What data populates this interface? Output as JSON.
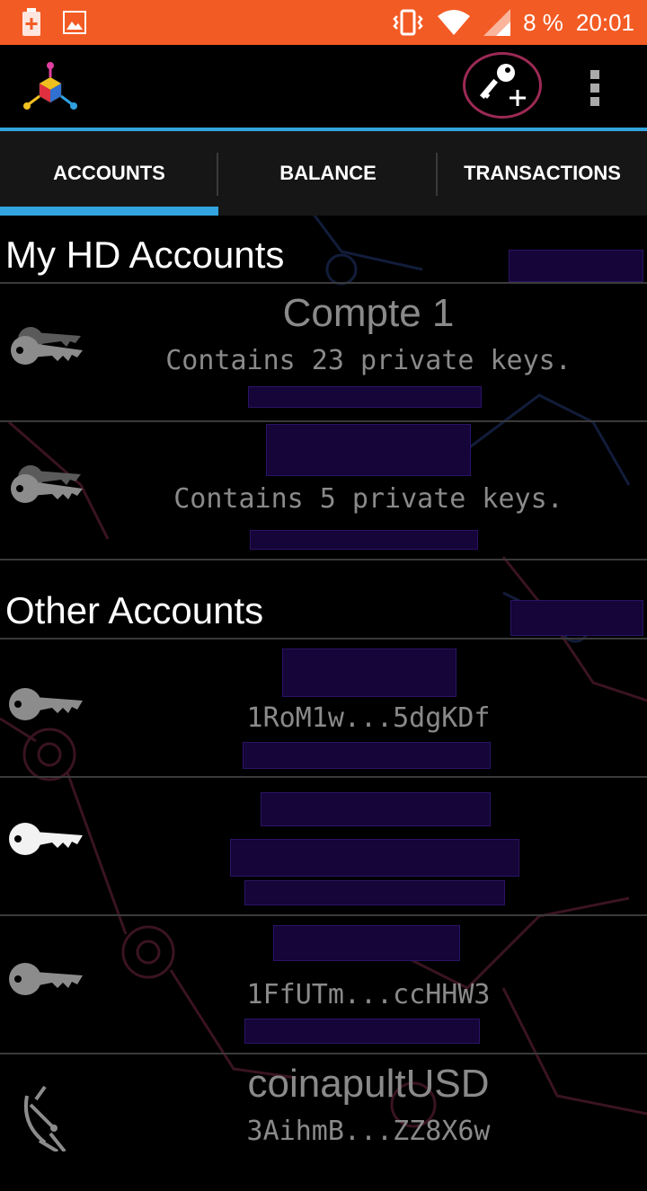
{
  "status_bar": {
    "battery_percent": "8 %",
    "time": "20:01",
    "icons": [
      "battery-saver-icon",
      "image-notification-icon",
      "vibrate-icon",
      "wifi-icon",
      "cell-signal-icon"
    ]
  },
  "action_bar": {
    "logo_icon": "mycelium-logo-icon",
    "add_key_icon": "add-key-icon",
    "overflow_icon": "overflow-menu-icon"
  },
  "tabs": [
    {
      "label": "ACCOUNTS",
      "selected": true
    },
    {
      "label": "BALANCE",
      "selected": false
    },
    {
      "label": "TRANSACTIONS",
      "selected": false
    }
  ],
  "sections": {
    "hd": {
      "title": "My HD Accounts"
    },
    "other": {
      "title": "Other Accounts"
    }
  },
  "hd_accounts": [
    {
      "name": "Compte 1",
      "detail": "Contains 23 private keys.",
      "icon": "multi-key-icon"
    },
    {
      "name": "",
      "detail": "Contains 5 private keys.",
      "icon": "multi-key-icon"
    }
  ],
  "other_accounts": [
    {
      "name": "",
      "address": "1RoM1w...5dgKDf",
      "icon": "key-icon"
    },
    {
      "name": "",
      "address": "",
      "icon": "key-icon",
      "active": true
    },
    {
      "name": "",
      "address": "1FfUTm...ccHHW3",
      "icon": "key-icon"
    },
    {
      "name": "coinapultUSD",
      "address": "3AihmB...ZZ8X6w",
      "icon": "satellite-dish-icon"
    }
  ],
  "colors": {
    "status_bar": "#F35B24",
    "accent_blue": "#33A4DF",
    "add_key_ring": "#9C2A55",
    "redaction": "#150538"
  }
}
